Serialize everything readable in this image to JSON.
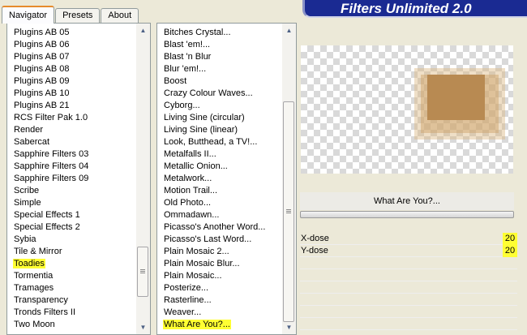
{
  "tabs": [
    {
      "label": "Navigator",
      "active": true
    },
    {
      "label": "Presets",
      "active": false
    },
    {
      "label": "About",
      "active": false
    }
  ],
  "banner": {
    "title": "Filters Unlimited 2.0"
  },
  "categories": {
    "items": [
      "Plugins AB 05",
      "Plugins AB 06",
      "Plugins AB 07",
      "Plugins AB 08",
      "Plugins AB 09",
      "Plugins AB 10",
      "Plugins AB 21",
      "RCS Filter Pak 1.0",
      "Render",
      "Sabercat",
      "Sapphire Filters 03",
      "Sapphire Filters 04",
      "Sapphire Filters 09",
      "Scribe",
      "Simple",
      "Special Effects 1",
      "Special Effects 2",
      "Sybia",
      "Tile & Mirror",
      "Toadies",
      "Tormentia",
      "Tramages",
      "Transparency",
      "Tronds Filters II",
      "Two Moon"
    ],
    "selected": "Toadies",
    "scroll_position": 0.93
  },
  "filters": {
    "items": [
      "Bitches Crystal...",
      "Blast 'em!...",
      "Blast 'n Blur",
      "Blur 'em!...",
      "Boost",
      "Crazy Colour Waves...",
      "Cyborg...",
      "Living Sine (circular)",
      "Living Sine (linear)",
      "Look, Butthead, a TV!...",
      "Metalfalls II...",
      "Metallic Onion...",
      "Metalwork...",
      "Motion Trail...",
      "Old Photo...",
      "Ommadawn...",
      "Picasso's Another Word...",
      "Picasso's Last Word...",
      "Plain Mosaic 2...",
      "Plain Mosaic Blur...",
      "Plain Mosaic...",
      "Posterize...",
      "Rasterline...",
      "Weaver...",
      "What Are You?..."
    ],
    "selected": "What Are You?...",
    "scroll_position": 1.0
  },
  "selected_filter": {
    "name": "What Are You?..."
  },
  "parameters": [
    {
      "label": "X-dose",
      "value": "20"
    },
    {
      "label": "Y-dose",
      "value": "20"
    }
  ],
  "colors": {
    "highlight": "#ffff33",
    "banner": "#1a2a92",
    "preview_object": "#b88a52"
  }
}
